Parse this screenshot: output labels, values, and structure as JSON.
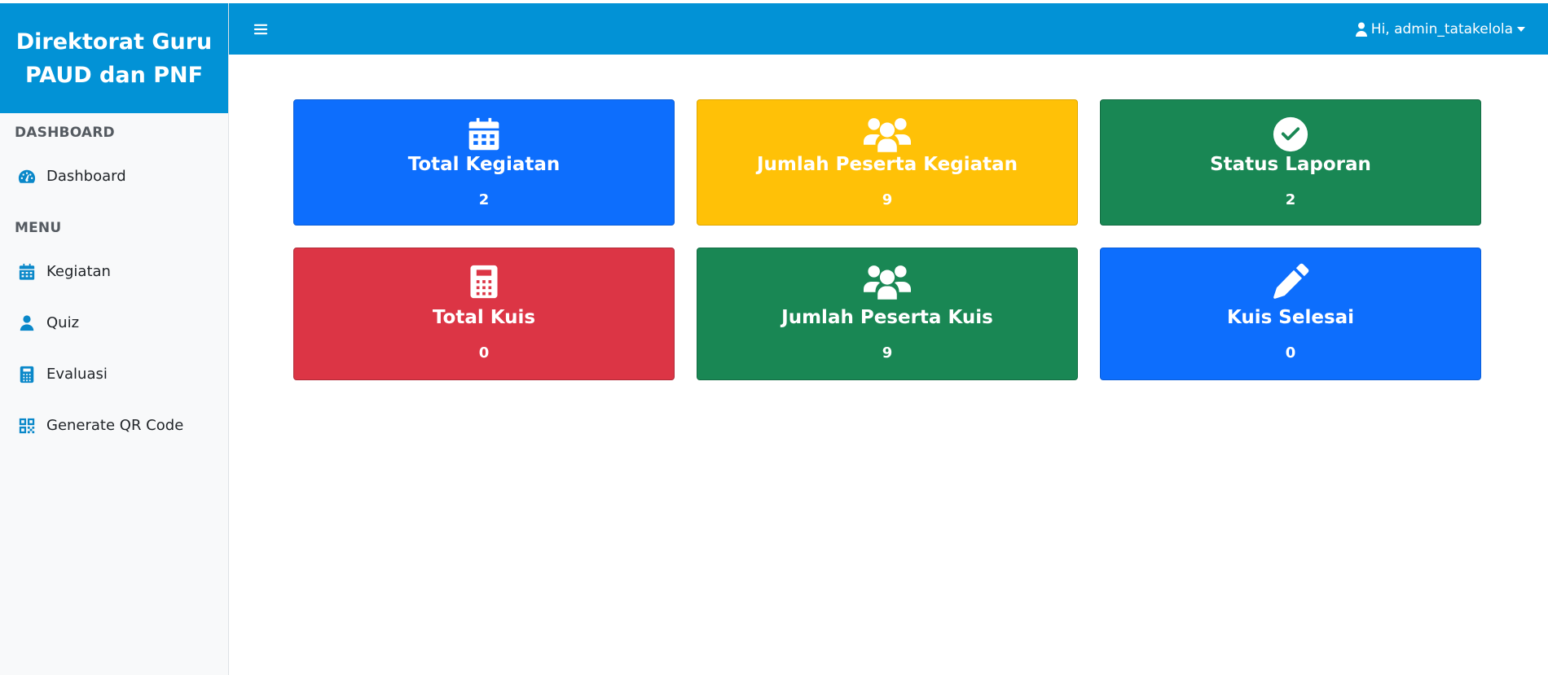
{
  "sidebar": {
    "brand": "Direktorat Guru PAUD dan PNF",
    "sections": {
      "dashboard_label": "DASHBOARD",
      "menu_label": "MENU"
    },
    "items": [
      {
        "label": "Dashboard",
        "icon": "gauge-icon"
      },
      {
        "label": "Kegiatan",
        "icon": "calendar-icon"
      },
      {
        "label": "Quiz",
        "icon": "user-icon"
      },
      {
        "label": "Evaluasi",
        "icon": "calculator-icon"
      },
      {
        "label": "Generate QR Code",
        "icon": "qrcode-icon"
      }
    ]
  },
  "topbar": {
    "menu_icon": "bars-icon",
    "user_greeting": "Hi, admin_tatakelola"
  },
  "cards": [
    {
      "title": "Total Kegiatan",
      "value": "2",
      "icon": "calendar-icon",
      "color": "#0d6efd"
    },
    {
      "title": "Jumlah Peserta Kegiatan",
      "value": "9",
      "icon": "users-icon",
      "color": "#ffc107"
    },
    {
      "title": "Status Laporan",
      "value": "2",
      "icon": "check-circle-icon",
      "color": "#198754"
    },
    {
      "title": "Total Kuis",
      "value": "0",
      "icon": "calculator-icon",
      "color": "#dc3545"
    },
    {
      "title": "Jumlah Peserta Kuis",
      "value": "9",
      "icon": "users-icon",
      "color": "#198754"
    },
    {
      "title": "Kuis Selesai",
      "value": "0",
      "icon": "pencil-icon",
      "color": "#0d6efd"
    }
  ],
  "colors": {
    "primary": "#0292d6",
    "sidebar_bg": "#f8f9fa",
    "icon_accent": "#0a88c9"
  }
}
